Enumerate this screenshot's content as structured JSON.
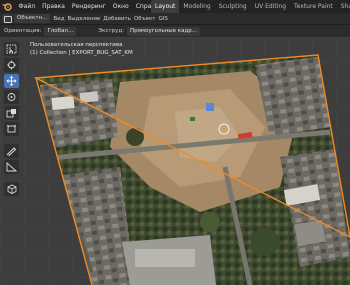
{
  "menu": [
    "Файл",
    "Правка",
    "Рендеринг",
    "Окно",
    "Справка"
  ],
  "workspace_tabs": [
    {
      "label": "Layout",
      "active": true
    },
    {
      "label": "Modeling",
      "active": false
    },
    {
      "label": "Sculpting",
      "active": false
    },
    {
      "label": "UV Editing",
      "active": false
    },
    {
      "label": "Texture Paint",
      "active": false
    },
    {
      "label": "Shading",
      "active": false
    }
  ],
  "header": {
    "mode": "Объектн...",
    "view": "Вид",
    "select": "Выделение",
    "add": "Добавить",
    "object": "Объект",
    "extra": "GIS"
  },
  "header2": {
    "orientation_label": "Ориентация:",
    "orientation_value": "Глобал...",
    "snap_label": "Экструд:",
    "snap_value": "Прямоугольные кадр..."
  },
  "viewport": {
    "view_name": "Пользовательская перспектива",
    "object_name": "(1) Collection | EXPORT_BUG_SAT_KM"
  },
  "icons": [
    "cursor-icon",
    "3d-cursor-icon",
    "move-icon",
    "rotate-icon",
    "scale-icon",
    "transform-icon",
    "annotate-icon",
    "measure-icon",
    "add-cube-icon"
  ],
  "colors": {
    "selection_outline": "#f08a24",
    "active_tool": "#4772b3"
  }
}
